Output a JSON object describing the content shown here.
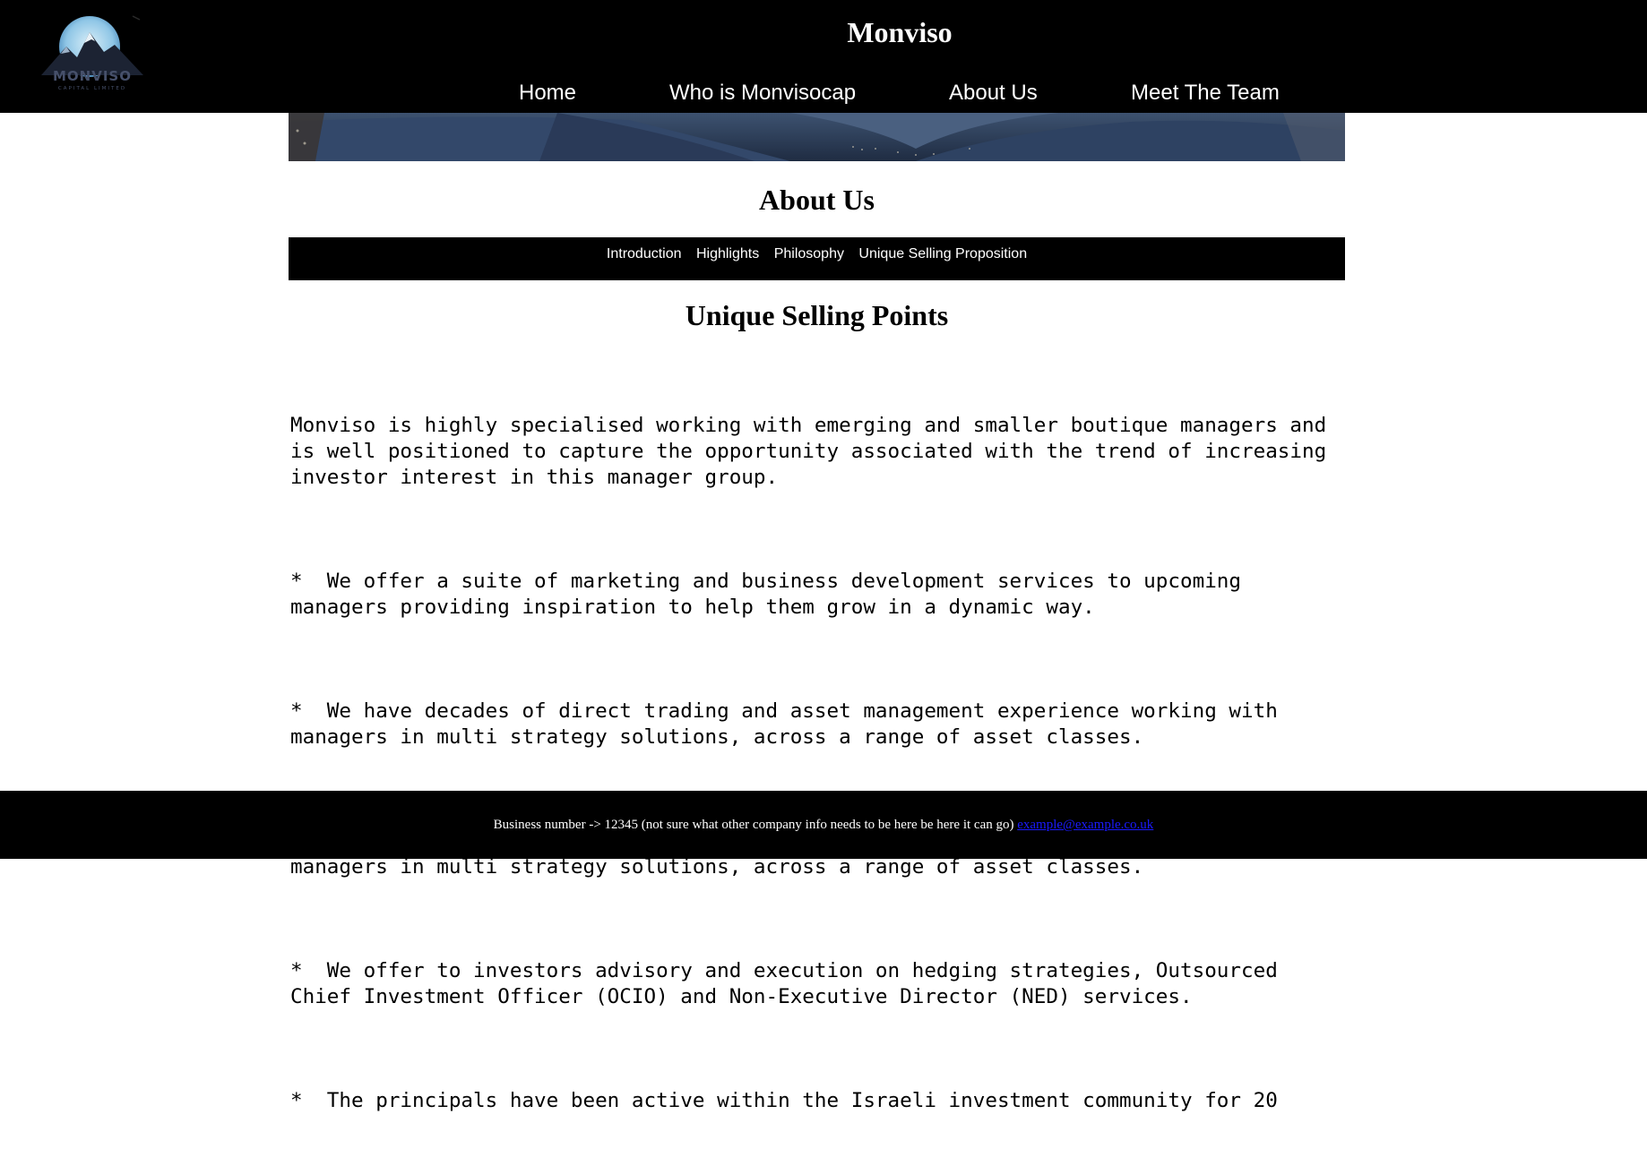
{
  "site": {
    "title": "Monviso",
    "logo_text": "MONVISO",
    "logo_subtext": "CAPITAL LIMITED"
  },
  "nav": {
    "items": [
      {
        "label": "Home"
      },
      {
        "label": "Who is Monvisocap"
      },
      {
        "label": "About Us"
      },
      {
        "label": "Meet The Team"
      }
    ]
  },
  "page": {
    "heading": "About Us",
    "subnav": [
      {
        "label": "Introduction"
      },
      {
        "label": "Highlights"
      },
      {
        "label": "Philosophy"
      },
      {
        "label": "Unique Selling Proposition"
      }
    ],
    "section_heading": "Unique Selling Points",
    "paragraphs": [
      "Monviso is highly specialised working with emerging and smaller boutique managers and is well positioned to capture the opportunity associated with the trend of increasing investor interest in this manager group.",
      "*  We offer a suite of marketing and business development services to upcoming managers providing inspiration to help them grow in a dynamic way.",
      "*  We have decades of direct trading and asset management experience working with managers in multi strategy solutions, across a range of asset classes.",
      "*  We have decades of direct trading and asset management experience working with managers in multi strategy solutions, across a range of asset classes.",
      "*  We offer to investors advisory and execution on hedging strategies, Outsourced Chief Investment Officer (OCIO) and Non-Executive Director (NED) services.",
      "*  The principals have been active within the Israeli investment community for 20"
    ]
  },
  "footer": {
    "text": "Business number -> 12345 (not sure what other company info needs to be here be here it can go)",
    "email": "example@example.co.uk"
  },
  "colors": {
    "header_bg": "#000000",
    "footer_link": "#1a1aff",
    "text": "#000000"
  }
}
